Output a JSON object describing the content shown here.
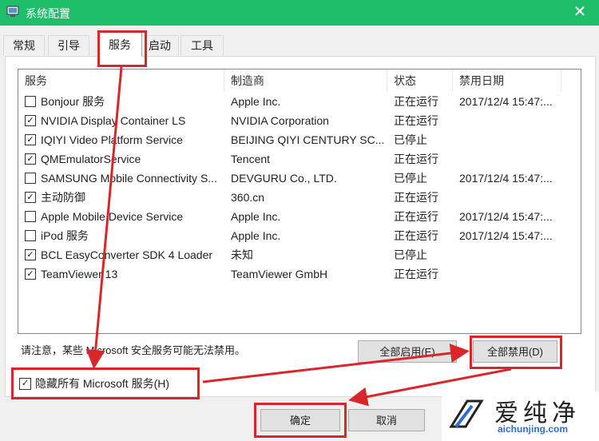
{
  "window": {
    "title": "系统配置",
    "close": "✕"
  },
  "tabs": [
    {
      "label": "常规"
    },
    {
      "label": "引导"
    },
    {
      "label": "服务"
    },
    {
      "label": "启动"
    },
    {
      "label": "工具"
    }
  ],
  "list": {
    "columns": {
      "service": "服务",
      "manufacturer": "制造商",
      "status": "状态",
      "disabled_date": "禁用日期"
    },
    "rows": [
      {
        "checked": false,
        "name": "Bonjour 服务",
        "maker": "Apple Inc.",
        "status": "正在运行",
        "date": "2017/12/4 15:47:..."
      },
      {
        "checked": true,
        "name": "NVIDIA Display Container LS",
        "maker": "NVIDIA Corporation",
        "status": "正在运行",
        "date": ""
      },
      {
        "checked": true,
        "name": "IQIYI Video Platform Service",
        "maker": "BEIJING QIYI CENTURY SC...",
        "status": "已停止",
        "date": ""
      },
      {
        "checked": true,
        "name": "QMEmulatorService",
        "maker": "Tencent",
        "status": "正在运行",
        "date": ""
      },
      {
        "checked": false,
        "name": "SAMSUNG Mobile Connectivity S...",
        "maker": "DEVGURU Co., LTD.",
        "status": "已停止",
        "date": "2017/12/4 15:47:..."
      },
      {
        "checked": true,
        "name": "主动防御",
        "maker": "360.cn",
        "status": "正在运行",
        "date": ""
      },
      {
        "checked": false,
        "name": "Apple Mobile Device Service",
        "maker": "Apple Inc.",
        "status": "正在运行",
        "date": "2017/12/4 15:47:..."
      },
      {
        "checked": false,
        "name": "iPod 服务",
        "maker": "Apple Inc.",
        "status": "正在运行",
        "date": "2017/12/4 15:47:..."
      },
      {
        "checked": true,
        "name": "BCL EasyConverter SDK 4 Loader",
        "maker": "未知",
        "status": "已停止",
        "date": ""
      },
      {
        "checked": true,
        "name": "TeamViewer 13",
        "maker": "TeamViewer GmbH",
        "status": "正在运行",
        "date": ""
      }
    ]
  },
  "note": "请注意，某些 Microsoft 安全服务可能无法禁用。",
  "buttons": {
    "enable_all": "全部启用(E)",
    "disable_all": "全部禁用(D)",
    "ok": "确定",
    "cancel": "取消"
  },
  "hide_ms": {
    "checked": true,
    "label": "隐藏所有 Microsoft 服务(H)"
  },
  "watermark": {
    "cn": "爱纯净",
    "en": "aichunjing.com"
  },
  "colors": {
    "titlebar": "#1fbe6a",
    "annotation": "#d9262b",
    "watermark_en": "#2a6fd6"
  }
}
